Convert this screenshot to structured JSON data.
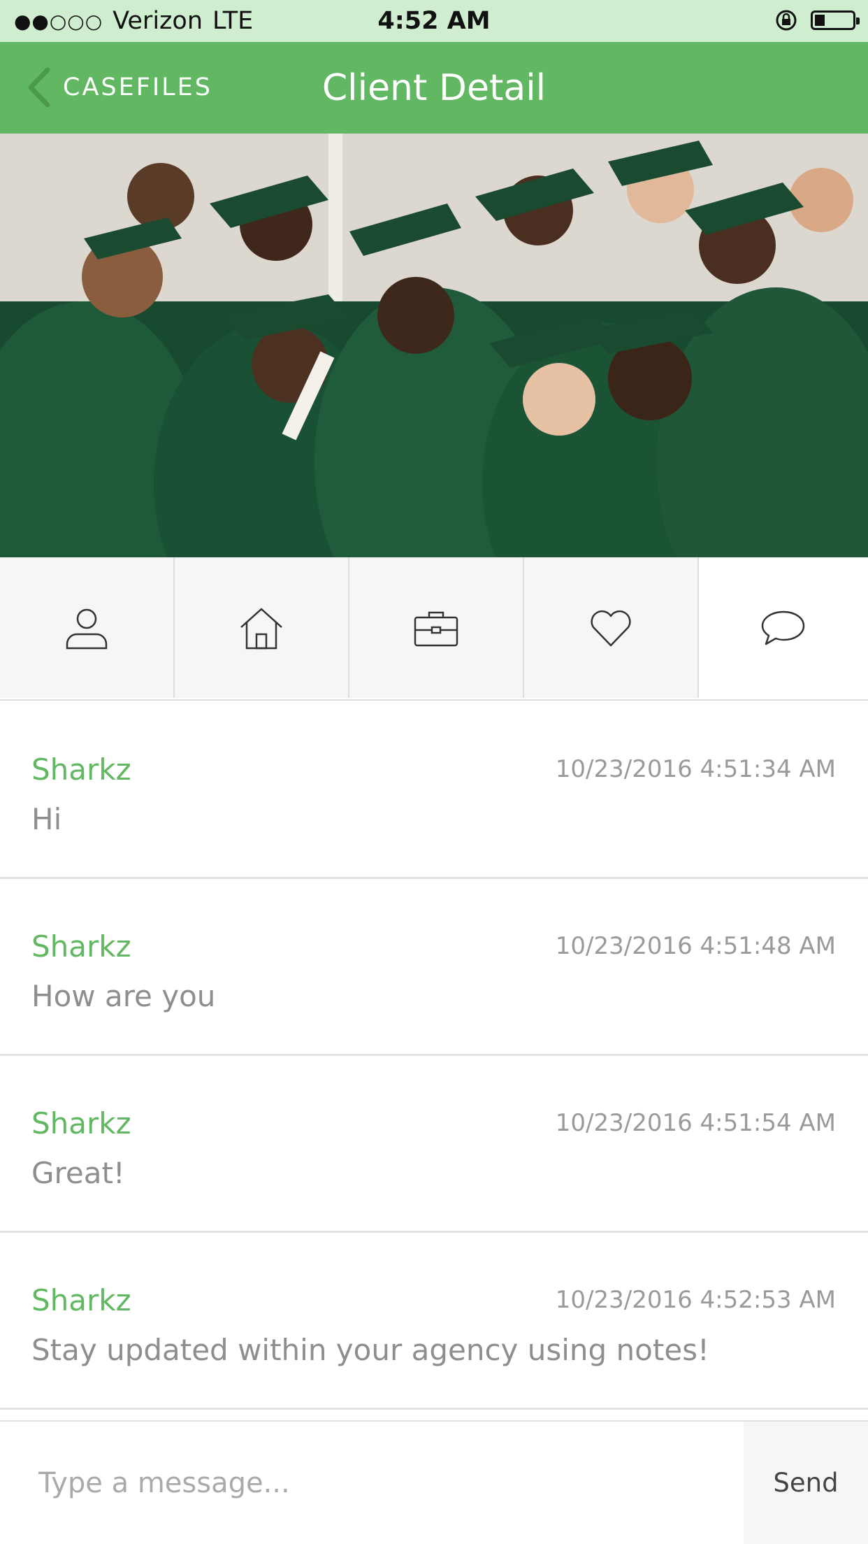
{
  "status_bar": {
    "carrier": "Verizon",
    "network": "LTE",
    "time": "4:52 AM",
    "signal_bars_filled": 2,
    "signal_bars_total": 5,
    "battery_level": 0.2
  },
  "nav": {
    "back_label": "CASEFILES",
    "title": "Client Detail"
  },
  "hero": {
    "icon": "graduation-group-photo"
  },
  "tabs": [
    {
      "icon": "person-icon",
      "active": false
    },
    {
      "icon": "home-icon",
      "active": false
    },
    {
      "icon": "briefcase-icon",
      "active": false
    },
    {
      "icon": "heart-icon",
      "active": false
    },
    {
      "icon": "chat-bubble-icon",
      "active": true
    }
  ],
  "messages": [
    {
      "author": "Sharkz",
      "timestamp": "10/23/2016 4:51:34 AM",
      "text": "Hi"
    },
    {
      "author": "Sharkz",
      "timestamp": "10/23/2016 4:51:48 AM",
      "text": "How are you"
    },
    {
      "author": "Sharkz",
      "timestamp": "10/23/2016 4:51:54 AM",
      "text": "Great!"
    },
    {
      "author": "Sharkz",
      "timestamp": "10/23/2016 4:52:53 AM",
      "text": "Stay updated within your agency using notes!"
    }
  ],
  "composer": {
    "placeholder": "Type a message...",
    "value": "",
    "send_label": "Send"
  },
  "colors": {
    "brand_green": "#62b862",
    "status_bar_bg": "#cfeecf",
    "tab_inactive_bg": "#f6f6f6"
  }
}
